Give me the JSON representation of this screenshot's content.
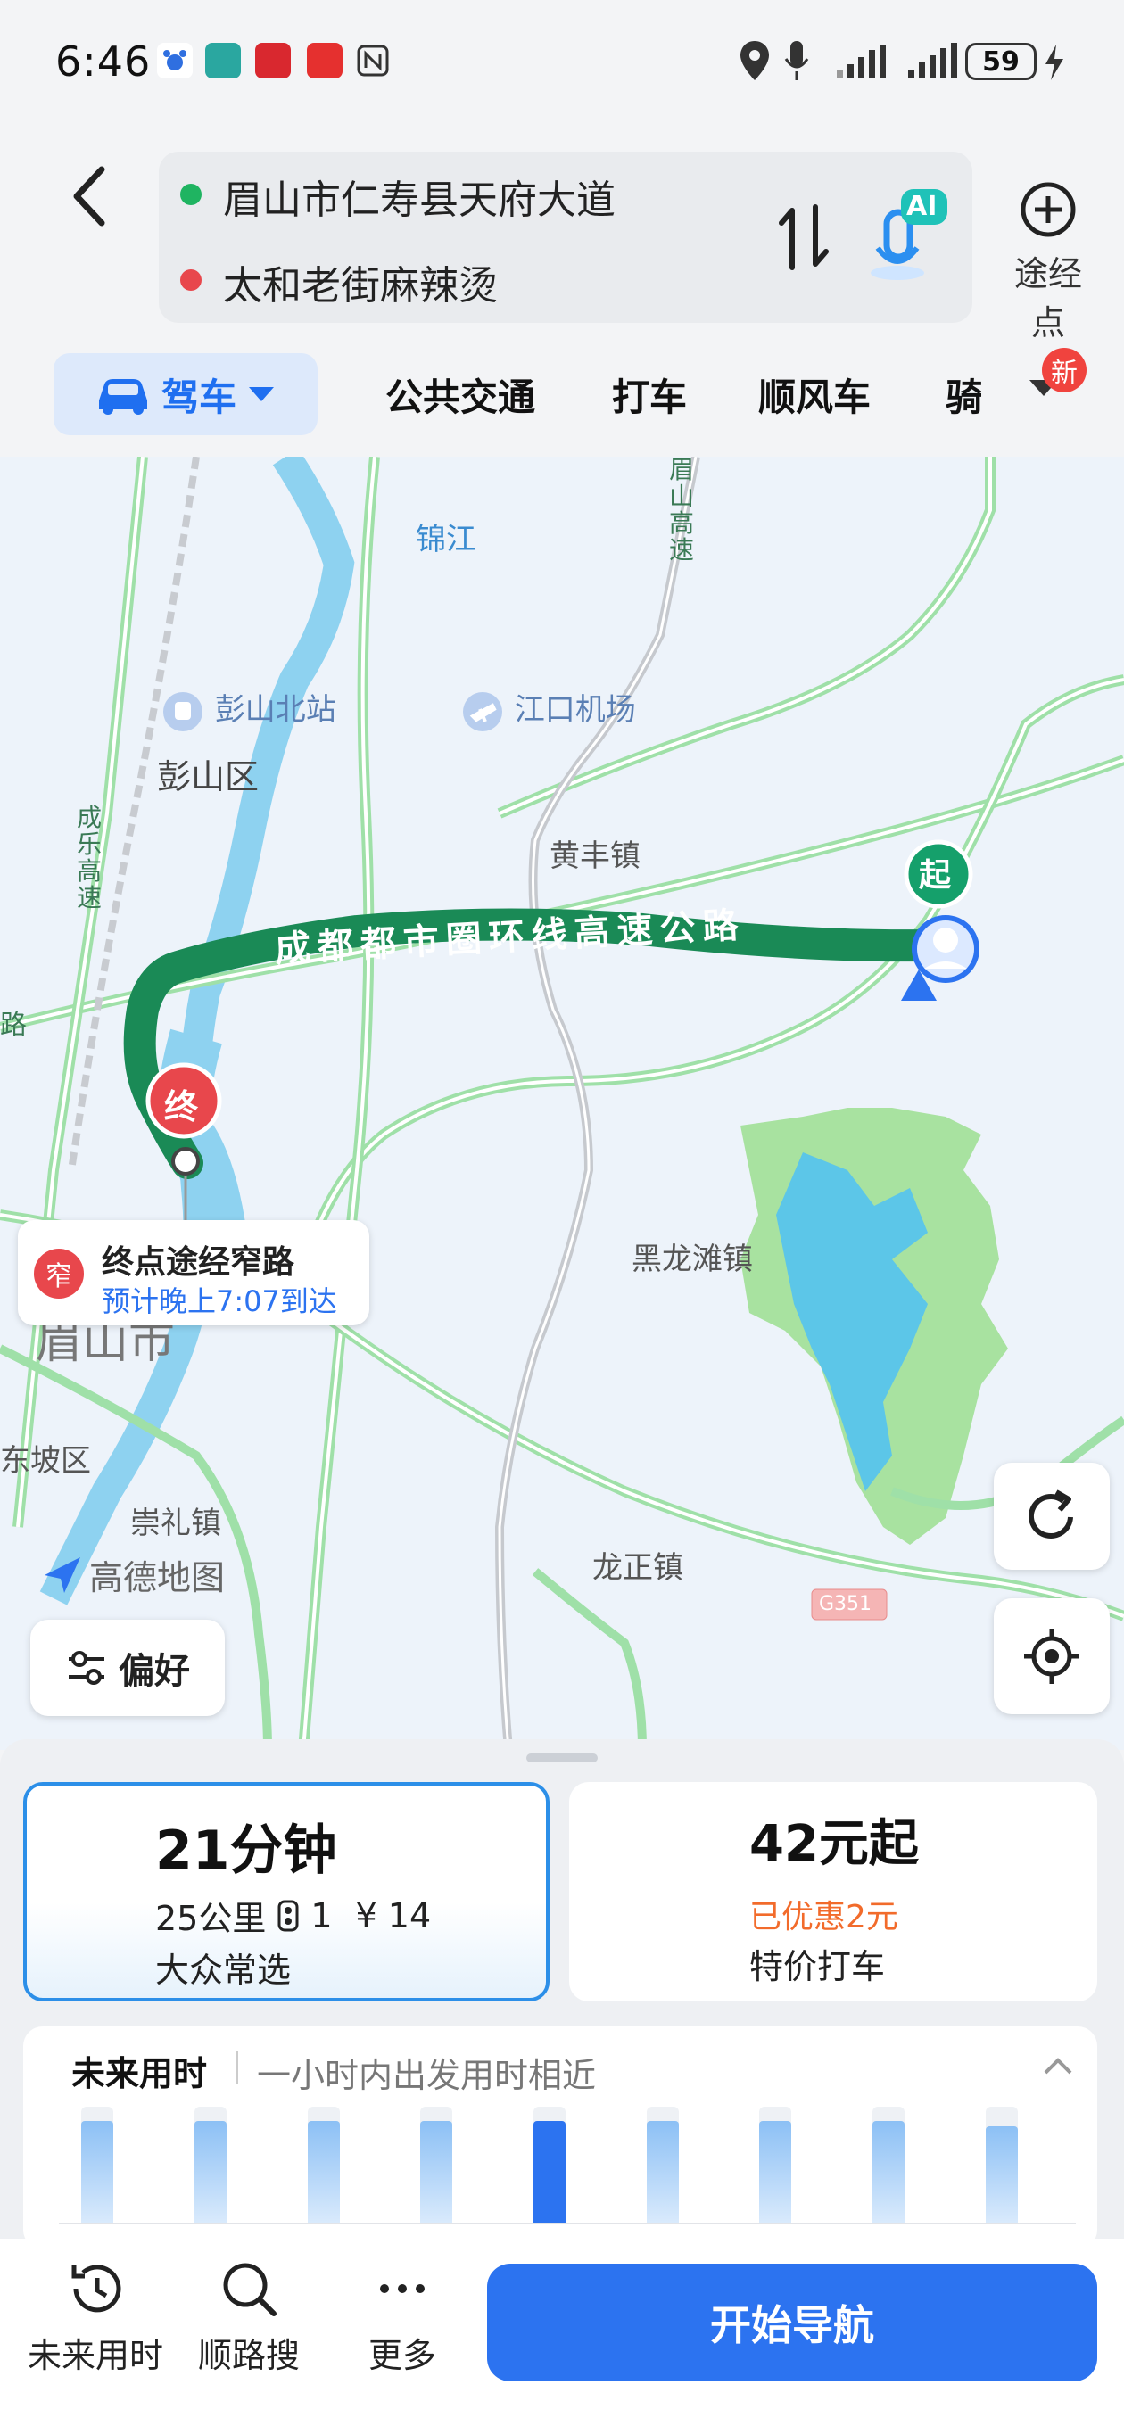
{
  "status": {
    "time": "6:46",
    "battery": "59"
  },
  "route": {
    "start": "眉山市仁寿县天府大道",
    "end": "太和老街麻辣烫",
    "ai_badge": "AI",
    "via_label": "途经点"
  },
  "tabs": {
    "drive": "驾车",
    "transit": "公共交通",
    "taxi": "打车",
    "carpool": "顺风车",
    "ride": "骑",
    "new_badge": "新"
  },
  "map": {
    "road_name": "成都都市圈环线高速公路",
    "start_marker": "起",
    "end_marker": "终",
    "labels": {
      "jinjiang": "锦江",
      "meigao": "眉山高速",
      "pengshan_north": "彭山北站",
      "jiangkou_airport": "江口机场",
      "pengshan_district": "彭山区",
      "chengle": "成乐高速",
      "huangfeng": "黄丰镇",
      "lu": "路",
      "heilongtan": "黑龙滩镇",
      "meishan": "眉山市",
      "dongpo": "东坡区",
      "chongli": "崇礼镇",
      "longzheng": "龙正镇",
      "g351": "G351",
      "amap": "高德地图"
    },
    "notice": {
      "icon": "窄",
      "title": "终点途经窄路",
      "subtitle": "预计晚上7:07到达"
    },
    "preference": "偏好"
  },
  "route_card": {
    "duration": "21分钟",
    "distance": "25公里",
    "lights": "1",
    "toll": "¥ 14",
    "tag": "大众常选"
  },
  "taxi_card": {
    "price": "42元起",
    "discount": "已优惠2元",
    "label": "特价打车"
  },
  "future": {
    "title": "未来用时",
    "subtitle": "一小时内出发用时相近",
    "bars": [
      0.95,
      0.95,
      0.95,
      0.95,
      0.95,
      0.95,
      0.95,
      0.95,
      0.9
    ],
    "selected_index": 4
  },
  "bottom_nav": {
    "future": "未来用时",
    "search_along": "顺路搜",
    "more": "更多",
    "start_nav": "开始导航"
  },
  "colors": {
    "accent": "#2c73f0",
    "route_green": "#1a8a56",
    "end_red": "#e8474c",
    "discount_orange": "#f26b2b"
  }
}
